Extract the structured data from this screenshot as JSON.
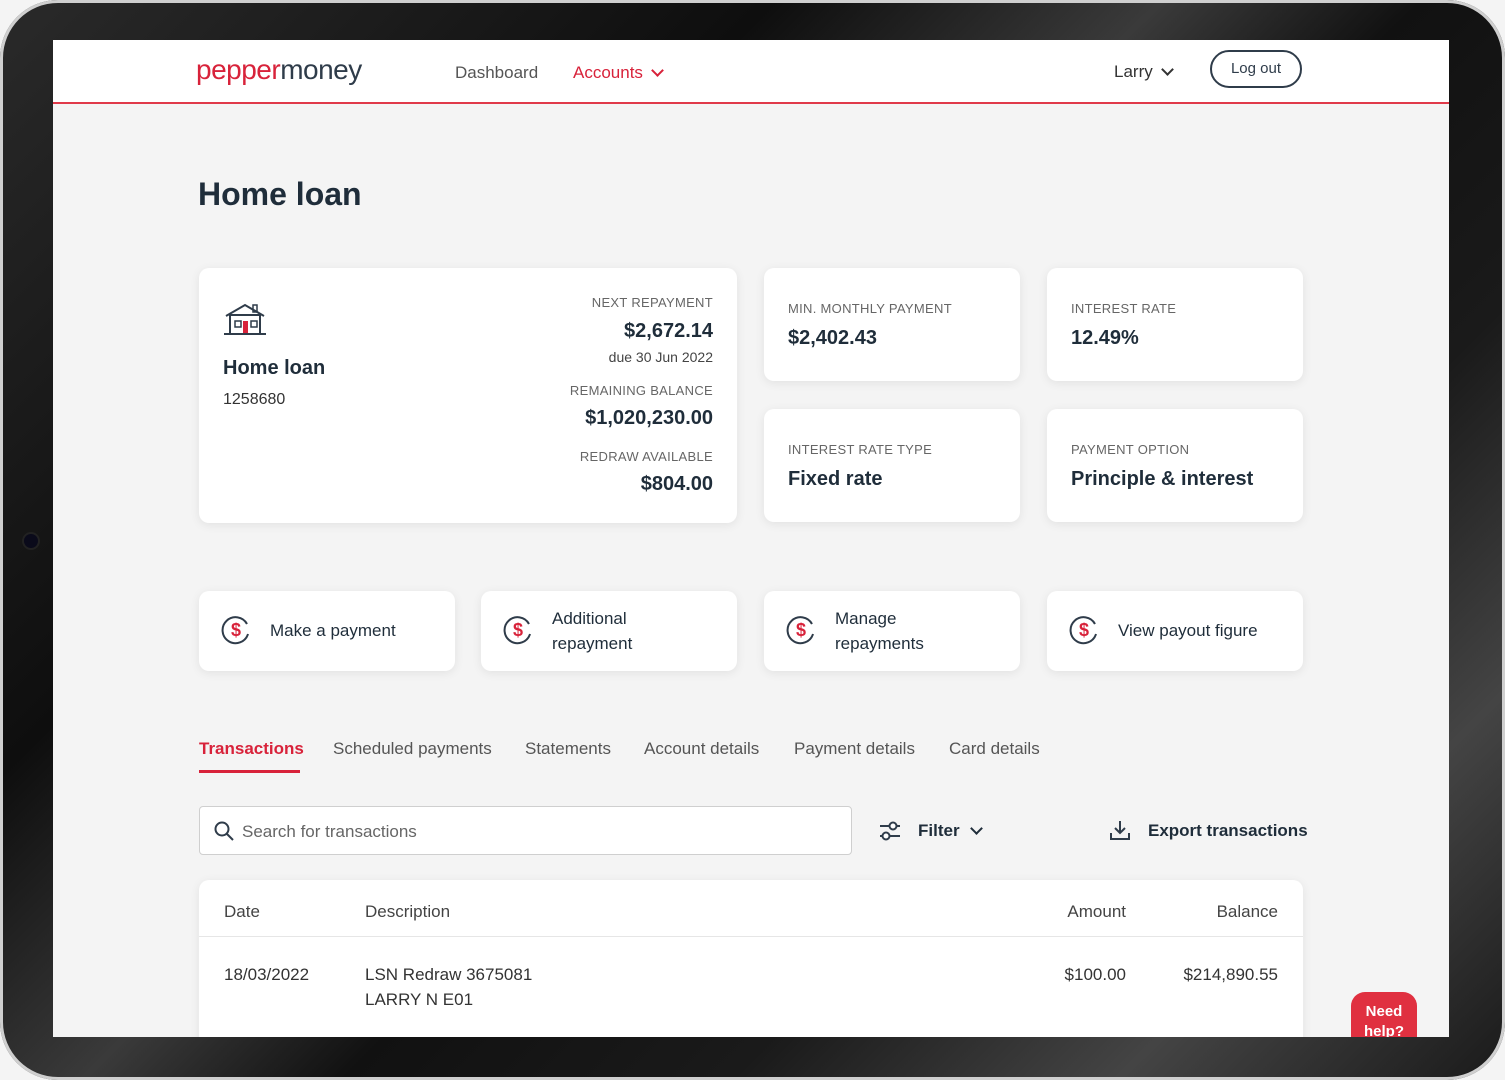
{
  "brand": {
    "part1": "pepper",
    "part2": "money"
  },
  "nav": {
    "dashboard": "Dashboard",
    "accounts": "Accounts",
    "user": "Larry",
    "logout": "Log out"
  },
  "page_title": "Home loan",
  "loan": {
    "name": "Home loan",
    "number": "1258680",
    "next_repayment_label": "NEXT REPAYMENT",
    "next_repayment_value": "$2,672.14",
    "next_repayment_due": "due 30 Jun 2022",
    "remaining_balance_label": "REMAINING BALANCE",
    "remaining_balance_value": "$1,020,230.00",
    "redraw_label": "REDRAW AVAILABLE",
    "redraw_value": "$804.00"
  },
  "info_cards": [
    {
      "label": "MIN. MONTHLY PAYMENT",
      "value": "$2,402.43"
    },
    {
      "label": "INTEREST RATE",
      "value": "12.49%"
    },
    {
      "label": "INTEREST RATE TYPE",
      "value": "Fixed rate"
    },
    {
      "label": "PAYMENT OPTION",
      "value": "Principle & interest"
    }
  ],
  "actions": [
    {
      "line1": "Make a payment",
      "line2": ""
    },
    {
      "line1": "Additional",
      "line2": "repayment"
    },
    {
      "line1": "Manage",
      "line2": "repayments"
    },
    {
      "line1": "View payout figure",
      "line2": ""
    }
  ],
  "tabs": [
    "Transactions",
    "Scheduled payments",
    "Statements",
    "Account details",
    "Payment details",
    "Card details"
  ],
  "search": {
    "placeholder": "Search for transactions"
  },
  "filter_label": "Filter",
  "export_label": "Export transactions",
  "table": {
    "headers": [
      "Date",
      "Description",
      "Amount",
      "Balance"
    ],
    "rows": [
      {
        "date": "18/03/2022",
        "description_line1": "LSN Redraw 3675081",
        "description_line2": "LARRY N E01",
        "amount": "$100.00",
        "balance": "$214,890.55"
      }
    ]
  },
  "help": {
    "line1": "Need",
    "line2": "help?"
  },
  "colors": {
    "brand_red": "#d8223a",
    "navy": "#1f2d3a",
    "background": "#f4f4f4"
  },
  "icons": [
    "house-icon",
    "dollar-circle-icon",
    "search-icon",
    "filter-icon",
    "download-icon",
    "chevron-down-icon"
  ]
}
